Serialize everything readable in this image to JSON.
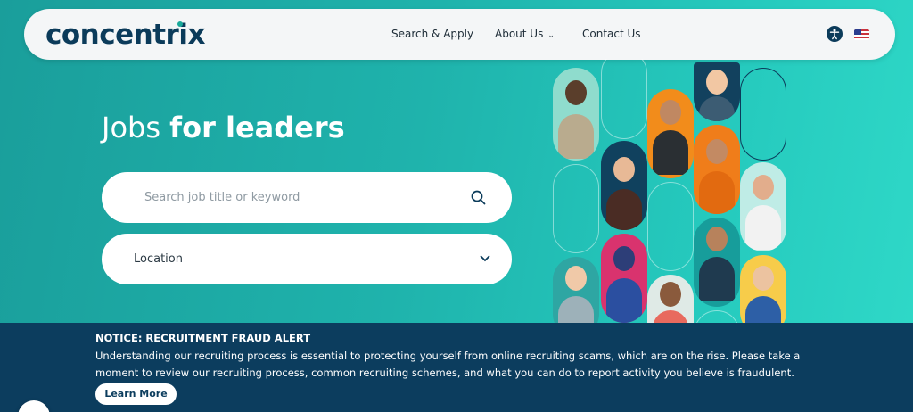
{
  "header": {
    "logo": "concentrix",
    "nav": {
      "search_apply": "Search & Apply",
      "about_us": "About Us",
      "contact_us": "Contact Us"
    },
    "accessibility_icon": "accessibility-icon",
    "language_icon": "us-flag-icon"
  },
  "hero": {
    "title_light": "Jobs ",
    "title_bold": "for leaders",
    "search": {
      "placeholder": "Search job title or keyword",
      "icon": "search-icon"
    },
    "location": {
      "label": "Location",
      "icon": "chevron-down-icon"
    }
  },
  "notice": {
    "title": "NOTICE: RECRUITMENT FRAUD ALERT",
    "body": "Understanding our recruiting process is essential to protecting yourself from online recruiting scams, which are on the rise. Please take a moment to review our recruiting process, common recruiting schemes, and what you can do to report activity you believe is fraudulent.",
    "button": "Learn More"
  },
  "colors": {
    "brand_navy": "#0b3b5a",
    "brand_teal": "#1fb3ac",
    "notice_bg": "#0c3d5e"
  }
}
